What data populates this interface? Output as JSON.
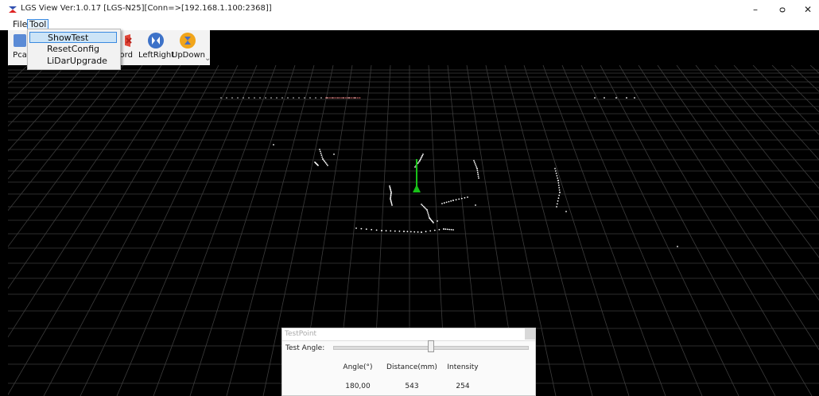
{
  "window": {
    "title": "LGS View   Ver:1.0.17  [LGS-N25][Conn=>[192.168.1.100:2368]]",
    "minimize_glyph": "–",
    "maximize_glyph": "ᴑ",
    "close_glyph": "✕"
  },
  "menubar": {
    "file": "File",
    "tool": "Tool"
  },
  "toolbar": {
    "items": [
      {
        "label": "Pca",
        "icon": "pcap-icon"
      },
      {
        "label": "cord",
        "icon": "record-icon"
      },
      {
        "label": "LeftRight",
        "icon": "left-right-flip-icon"
      },
      {
        "label": "UpDown",
        "icon": "up-down-flip-icon"
      }
    ],
    "overflow_glyph": "⌄"
  },
  "tool_menu": {
    "items": [
      "ShowTest",
      "ResetConfig",
      "LiDarUpgrade"
    ],
    "highlighted": "ShowTest"
  },
  "test_point": {
    "title": "TestPoint",
    "angle_label": "Test Angle:",
    "slider_value": 0.5,
    "headers": [
      "Angle(°)",
      "Distance(mm)",
      "Intensity"
    ],
    "values": [
      "180,00",
      "543",
      "254"
    ]
  },
  "colors": {
    "background": "#000000",
    "grid": "#3c3c3c",
    "points": "#ffffff",
    "top_wall_points": "#ff8080",
    "direction_arrow": "#18c018",
    "accent": "#3a8ae0"
  }
}
